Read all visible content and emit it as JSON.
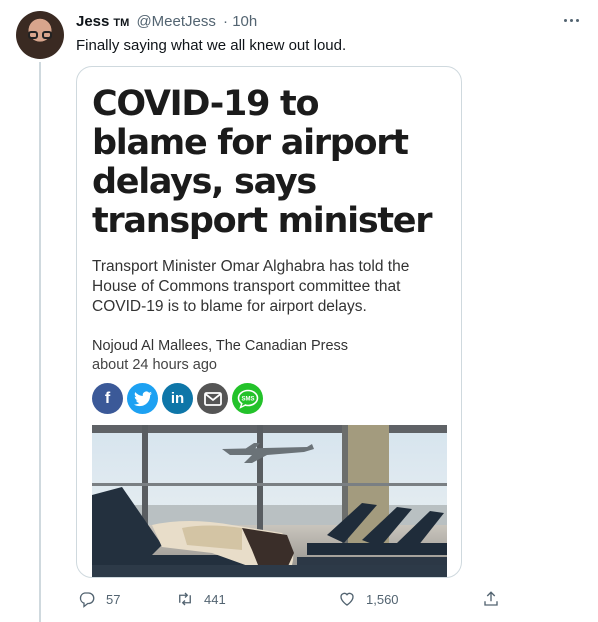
{
  "tweet": {
    "name": "Jess",
    "badge": "TM",
    "handle": "@MeetJess",
    "time": "· 10h",
    "text": "Finally saying what we all knew out loud."
  },
  "card": {
    "headline": "COVID-19 to blame for airport delays, says transport minister",
    "summary": "Transport Minister Omar Alghabra has told the House of Commons transport committee that COVID-19 is to blame for airport delays.",
    "author": "Nojoud Al Mallees, The Canadian Press",
    "timestamp": "about 24 hours ago",
    "share_buttons": [
      {
        "icon": "facebook-icon",
        "glyph": "f",
        "color": "#3b5998"
      },
      {
        "icon": "twitter-icon",
        "glyph": "",
        "color": "#1da1f2"
      },
      {
        "icon": "linkedin-icon",
        "glyph": "in",
        "color": "#0e76a8"
      },
      {
        "icon": "email-icon",
        "glyph": "",
        "color": "#555555"
      },
      {
        "icon": "sms-icon",
        "glyph": "SMS",
        "color": "#23c22a"
      }
    ]
  },
  "actions": {
    "replies": "57",
    "retweets": "441",
    "likes": "1,560"
  },
  "colors": {
    "text": "#0f1419",
    "secondary": "#536471",
    "border": "#cfd9de"
  }
}
